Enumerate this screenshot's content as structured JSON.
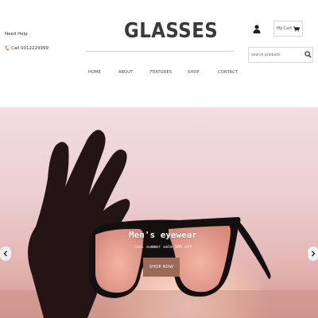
{
  "header": {
    "help_title": "Need Help",
    "phone_text": "Call 0012229999",
    "logo": "GLASSES",
    "cart_label": "My Cart",
    "search_placeholder": "Search products"
  },
  "nav": {
    "items": [
      {
        "label": "HOME"
      },
      {
        "label": "ABOUT"
      },
      {
        "label": "FEATURES"
      },
      {
        "label": "SHOP"
      },
      {
        "label": "CONTACT"
      }
    ]
  },
  "hero": {
    "title": "Men's eyewear",
    "subtitle": "Cool summer sale 50% off",
    "button_label": "SHOP NOW"
  },
  "colors": {
    "accent": "#9c6b58",
    "phone_icon": "#e8641b"
  },
  "icons": [
    "phone-icon",
    "user-icon",
    "cart-icon",
    "search-icon",
    "chevron-left-icon",
    "chevron-right-icon"
  ]
}
